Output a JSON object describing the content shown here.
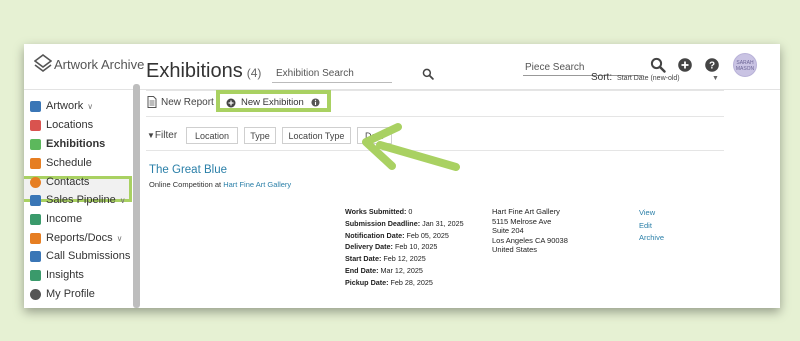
{
  "app": {
    "title": "Artwork Archive"
  },
  "topbar": {
    "piece_search_placeholder": "Piece Search",
    "avatar_text": "SARAH MASON"
  },
  "sidebar": {
    "items": [
      {
        "label": "Artwork",
        "icon": "image-icon",
        "chevron": "∨"
      },
      {
        "label": "Locations",
        "icon": "location-arrow-icon"
      },
      {
        "label": "Exhibitions",
        "icon": "map-pin-icon"
      },
      {
        "label": "Schedule",
        "icon": "calendar-icon"
      },
      {
        "label": "Contacts",
        "icon": "person-icon"
      },
      {
        "label": "Sales Pipeline",
        "icon": "trend-line-icon",
        "chevron": "∨"
      },
      {
        "label": "Income",
        "icon": "cash-icon"
      },
      {
        "label": "Reports/Docs",
        "icon": "folder-icon",
        "chevron": "∨"
      },
      {
        "label": "Call Submissions",
        "icon": "calendar-check-icon"
      },
      {
        "label": "Insights",
        "icon": "bar-chart-icon"
      },
      {
        "label": "My Profile",
        "icon": "globe-icon"
      }
    ]
  },
  "page": {
    "title": "Exhibitions",
    "count": "(4)",
    "search_placeholder": "Exhibition Search",
    "sort_label": "Sort:",
    "sort_value": "Start Date (new-old)"
  },
  "actions": {
    "new_report": "New Report",
    "new_exhibition": "New Exhibition"
  },
  "filters": {
    "label": "Filter",
    "buttons": [
      "Location",
      "Type",
      "Location Type",
      "Date"
    ]
  },
  "exhibition": {
    "title": "The Great Blue",
    "type_text": "Online Competition at",
    "venue": "Hart Fine Art Gallery",
    "details": [
      {
        "label": "Works Submitted:",
        "value": "0"
      },
      {
        "label": "Submission Deadline:",
        "value": "Jan 31, 2025"
      },
      {
        "label": "Notification Date:",
        "value": "Feb 05, 2025"
      },
      {
        "label": "Delivery Date:",
        "value": "Feb 10, 2025"
      },
      {
        "label": "Start Date:",
        "value": "Feb 12, 2025"
      },
      {
        "label": "End Date:",
        "value": "Mar 12, 2025"
      },
      {
        "label": "Pickup Date:",
        "value": "Feb 28, 2025"
      }
    ],
    "address": [
      "Hart Fine Art Gallery",
      "5115 Melrose Ave",
      "Suite 204",
      "Los Angeles CA 90038",
      "United States"
    ],
    "row_actions": [
      "View",
      "Edit",
      "Archive"
    ]
  },
  "colors": {
    "highlight": "#a9d162",
    "link": "#2a7fa8",
    "background": "#e6f1d3"
  }
}
